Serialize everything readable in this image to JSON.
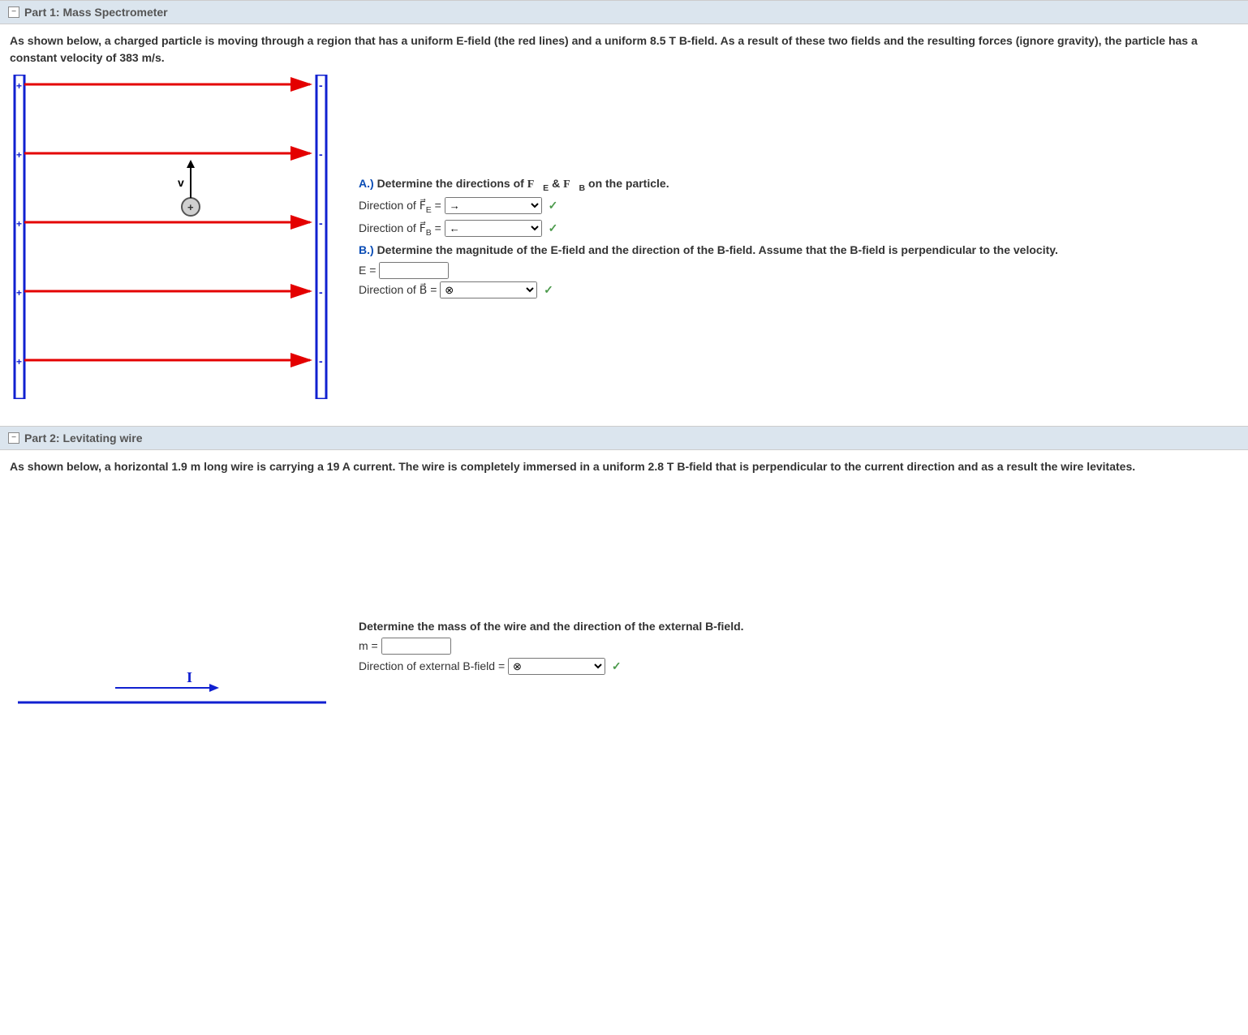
{
  "part1": {
    "header": "Part 1: Mass Spectrometer",
    "intro": "As shown below, a charged particle is moving through a region that has a uniform E-field (the red lines) and a uniform 8.5 T B-field. As a result of these two fields and the resulting forces (ignore gravity), the particle has a constant velocity of 383 m/s.",
    "a_label": "A.)",
    "a_text": "Determine the directions of F⃗E & F⃗B on the particle.",
    "fe_label": "Direction of F⃗E = ",
    "fe_value": "→",
    "fb_label": "Direction of F⃗B = ",
    "fb_value": "←",
    "b_label": "B.)",
    "b_text": "Determine the magnitude of the E-field and the direction of the B-field. Assume that the B-field is perpendicular to the velocity.",
    "e_label": "E = ",
    "e_value": "",
    "bdir_label": "Direction of B⃗ = ",
    "bdir_value": "⊗"
  },
  "part2": {
    "header": "Part 2: Levitating wire",
    "intro": "As shown below, a horizontal 1.9 m long wire is carrying a 19 A current. The wire is completely immersed in a uniform 2.8 T B-field that is perpendicular to the current direction and as a result the wire levitates.",
    "q_text": "Determine the mass of the wire and the direction of the external B-field.",
    "m_label": "m = ",
    "m_value": "",
    "bext_label": "Direction of external B-field = ",
    "bext_value": "⊗"
  },
  "icons": {
    "collapse": "−",
    "check": "✓"
  },
  "diagram": {
    "v_label": "v",
    "i_label": "I",
    "plus": "+"
  }
}
